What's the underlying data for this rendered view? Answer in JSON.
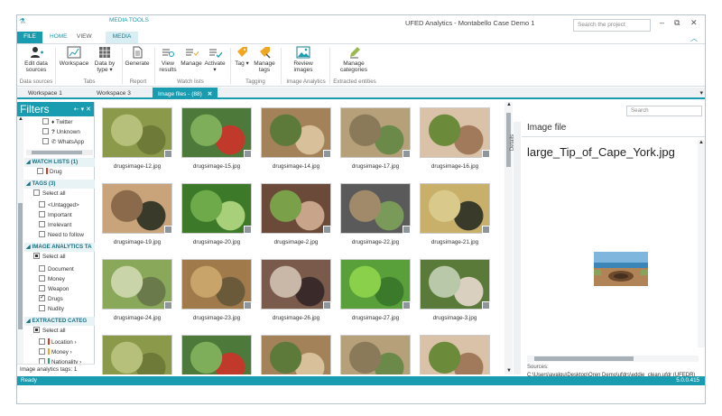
{
  "window": {
    "title": "UFED Analytics - Montabello Case Demo 1",
    "context_label": "MEDIA TOOLS",
    "search_placeholder": "Search the project",
    "minimize": "–",
    "restore": "⧉",
    "close": "✕",
    "collapse_ribbon": "︿"
  },
  "ribbon_tabs": {
    "file": "FILE",
    "home": "HOME",
    "view": "VIEW",
    "media": "MEDIA"
  },
  "ribbon": {
    "edit_data_sources": "Edit data sources",
    "workspace": "Workspace",
    "data_by_type": "Data by type ▾",
    "generate": "Generate",
    "view_results": "View results",
    "manage": "Manage",
    "activate": "Activate ▾",
    "tag": "Tag ▾",
    "manage_tags": "Manage tags",
    "review_images": "Review images",
    "manage_categories": "Manage categories",
    "groups": {
      "data_sources": "Data sources",
      "tabs": "Tabs",
      "report": "Report",
      "watch_lists": "Watch lists",
      "tagging": "Tagging",
      "image_analytics": "Image Analytics",
      "extracted_entities": "Extracted entities"
    }
  },
  "doc_tabs": {
    "tab1": "Workspace 1",
    "tab2": "Workspace 3",
    "tab3": "Image files - (88)",
    "close": "✕",
    "overflow": "▾"
  },
  "filters": {
    "title": "Filters",
    "controls": "⇠ ▾ ✕",
    "twitter": "Twitter",
    "unknown": "Unknown",
    "whatsapp": "WhatsApp",
    "watch_lists_header": "WATCH LISTS (1)",
    "drug": "Drug",
    "tags_header": "TAGS (3)",
    "select_all": "Select all",
    "untagged": "<Untagged>",
    "important": "Important",
    "irrelevant": "Irrelevant",
    "need_to_follow": "Need to follow",
    "image_analytics_header": "IMAGE ANALYTICS TA",
    "document": "Document",
    "money": "Money",
    "weapon": "Weapon",
    "drugs": "Drugs",
    "nudity": "Nudity",
    "extracted_header": "EXTRACTED CATEG",
    "location": "Location",
    "money2": "Money",
    "nationality": "Nationality",
    "footer": "Image analytics tags: 1"
  },
  "gallery": {
    "items": [
      "drugsimage-12.jpg",
      "drugsimage-15.jpg",
      "drugsimage-14.jpg",
      "drugsimage-17.jpg",
      "drugsimage-16.jpg",
      "drugsimage-19.jpg",
      "drugsimage-20.jpg",
      "drugsimage-2.jpg",
      "drugsimage-22.jpg",
      "drugsimage-21.jpg",
      "drugsimage-24.jpg",
      "drugsimage-23.jpg",
      "drugsimage-26.jpg",
      "drugsimage-27.jpg",
      "drugsimage-3.jpg"
    ]
  },
  "details": {
    "tab_label": "Details",
    "search_placeholder": "Search",
    "header": "Image file",
    "file_name": "large_Tip_of_Cape_York.jpg",
    "sources_label": "Sources:",
    "source_path": "C:\\Users\\ayalgu\\Desktop\\Oren Demo\\ufdrs\\eddie_clean.ufdr (UFEDR)"
  },
  "status": {
    "text": "Ready",
    "version": "5.0.0.415"
  },
  "colors": {
    "accent": "#1a9cb0",
    "location": "#e0341f",
    "money": "#f0a623",
    "nationality": "#2aa06a"
  }
}
